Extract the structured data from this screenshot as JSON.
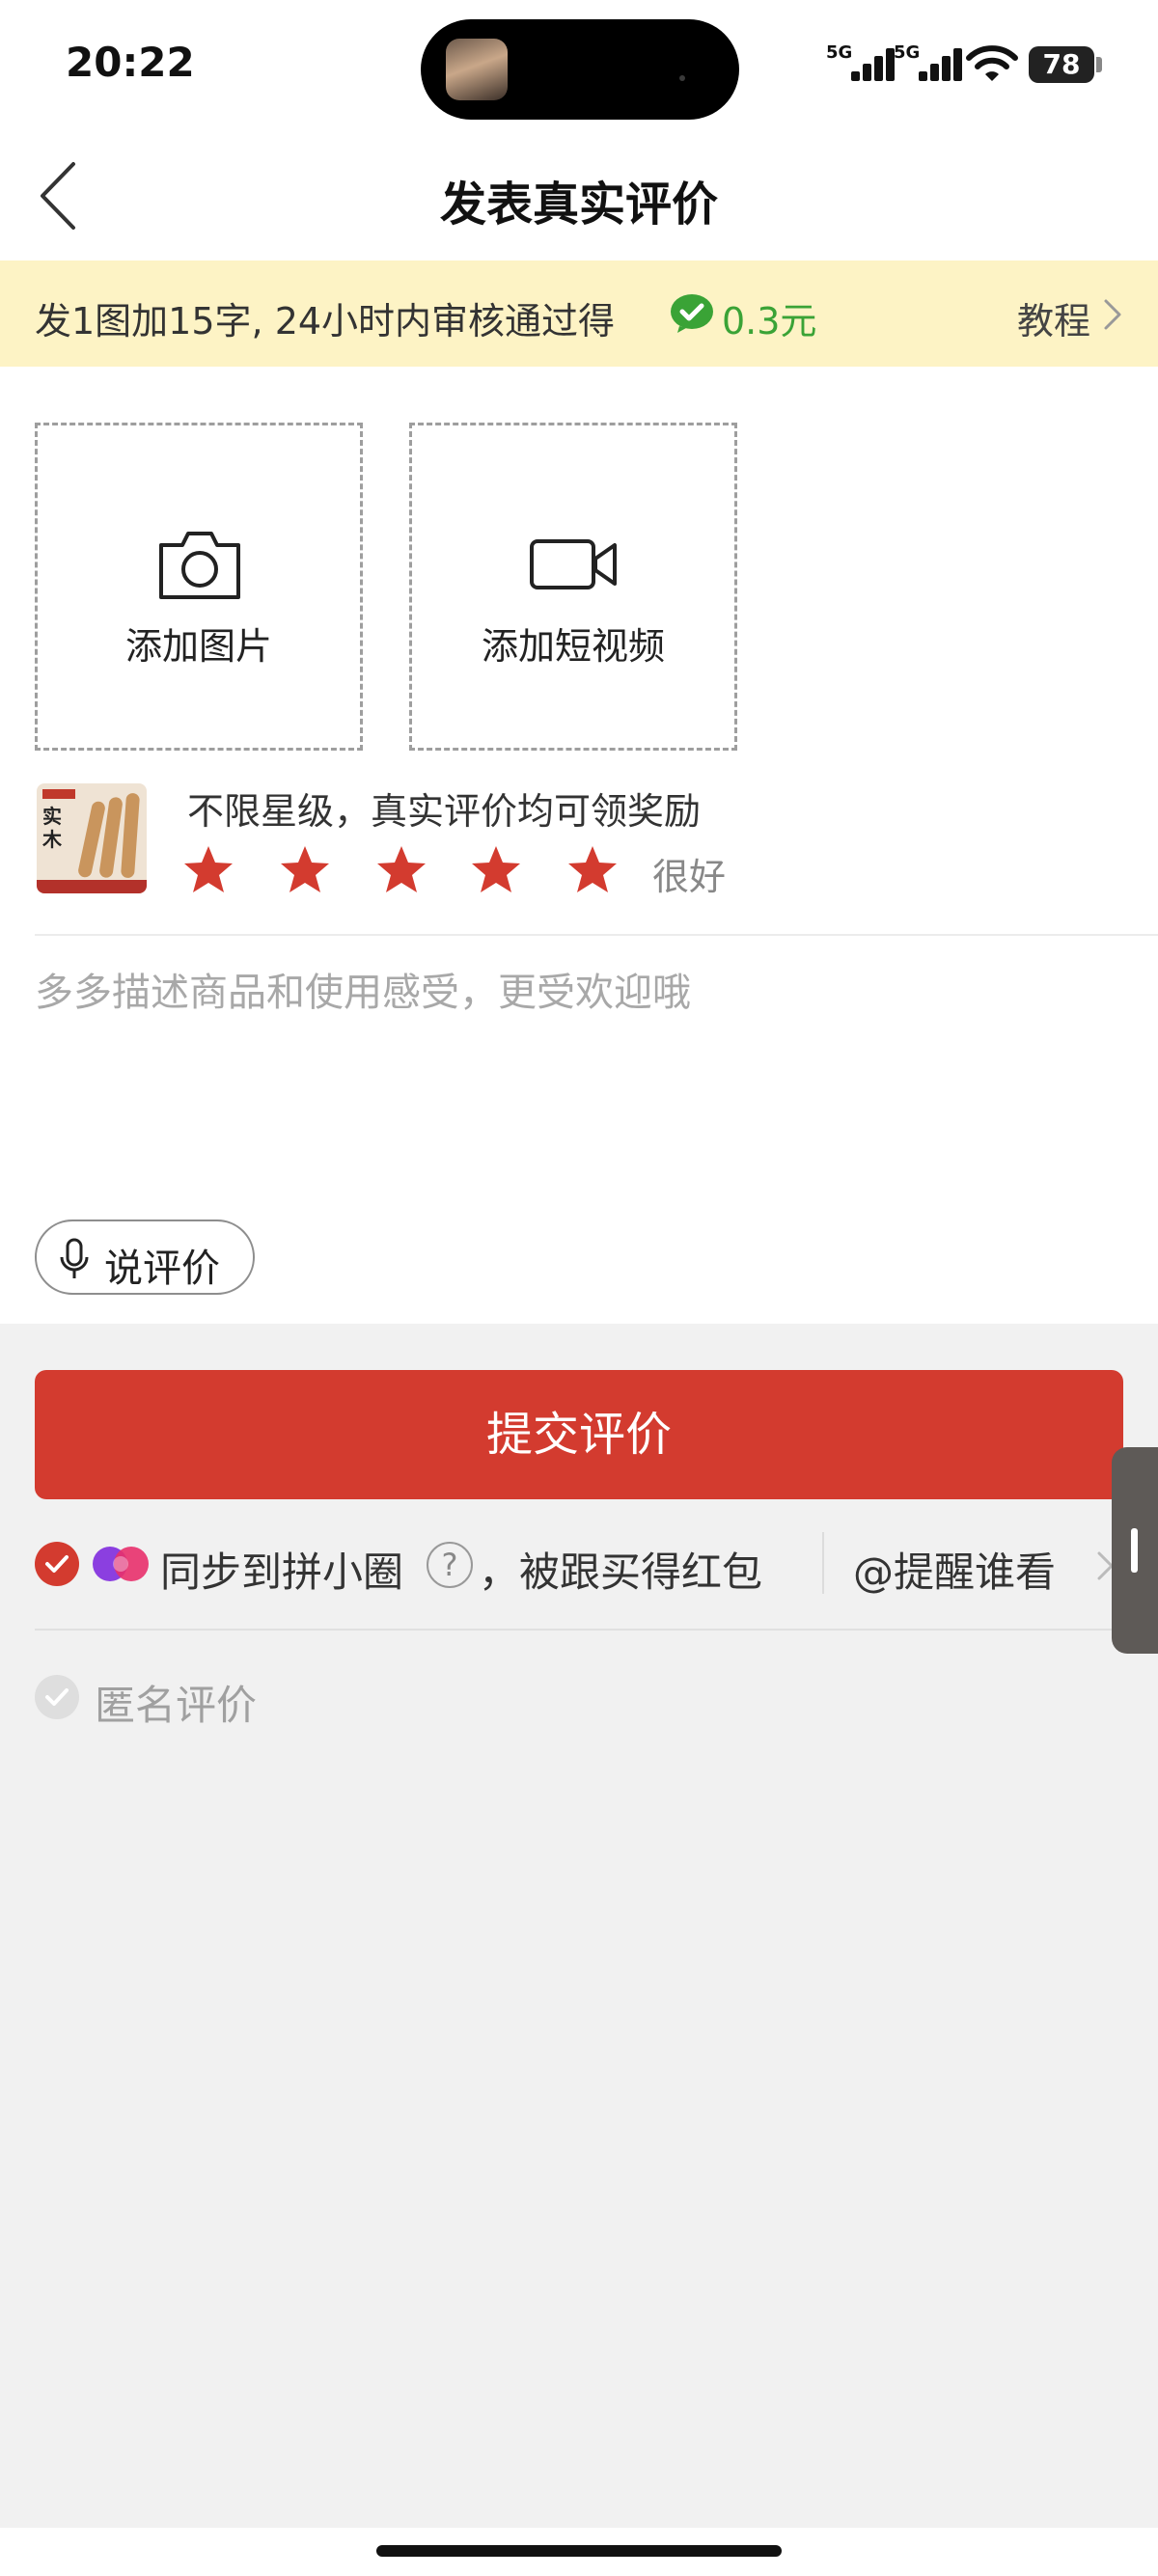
{
  "status_bar": {
    "time": "20:22",
    "signal_1_label": "5G",
    "signal_2_label": "5G",
    "battery": "78",
    "icons": [
      "signal-icon",
      "wifi-icon",
      "battery-icon"
    ]
  },
  "nav": {
    "title": "发表真实评价",
    "back_icon": "chevron-left-icon"
  },
  "banner": {
    "text": "发1图加15字, 24小时内审核通过得",
    "reward": "0.3元",
    "tutorial": "教程",
    "reward_color": "#3aa336"
  },
  "upload": {
    "add_image": "添加图片",
    "add_video": "添加短视频"
  },
  "product": {
    "hint": "不限星级，真实评价均可领奖励",
    "thumb_word": "实木",
    "stars": 5,
    "stars_max": 5,
    "rating_text": "很好",
    "star_color": "#d33b2f"
  },
  "comment": {
    "placeholder": "多多描述商品和使用感受，更受欢迎哦",
    "value": ""
  },
  "voice": {
    "label": "说评价"
  },
  "submit": {
    "label": "提交评价",
    "color": "#d33b2f"
  },
  "options": {
    "sync_checked": true,
    "sync_label": "同步到拼小圈",
    "sync_suffix": "，被跟买得红包",
    "help": "?",
    "mention": "@提醒谁看",
    "anonymous_checked": false,
    "anonymous_label": "匿名评价"
  }
}
